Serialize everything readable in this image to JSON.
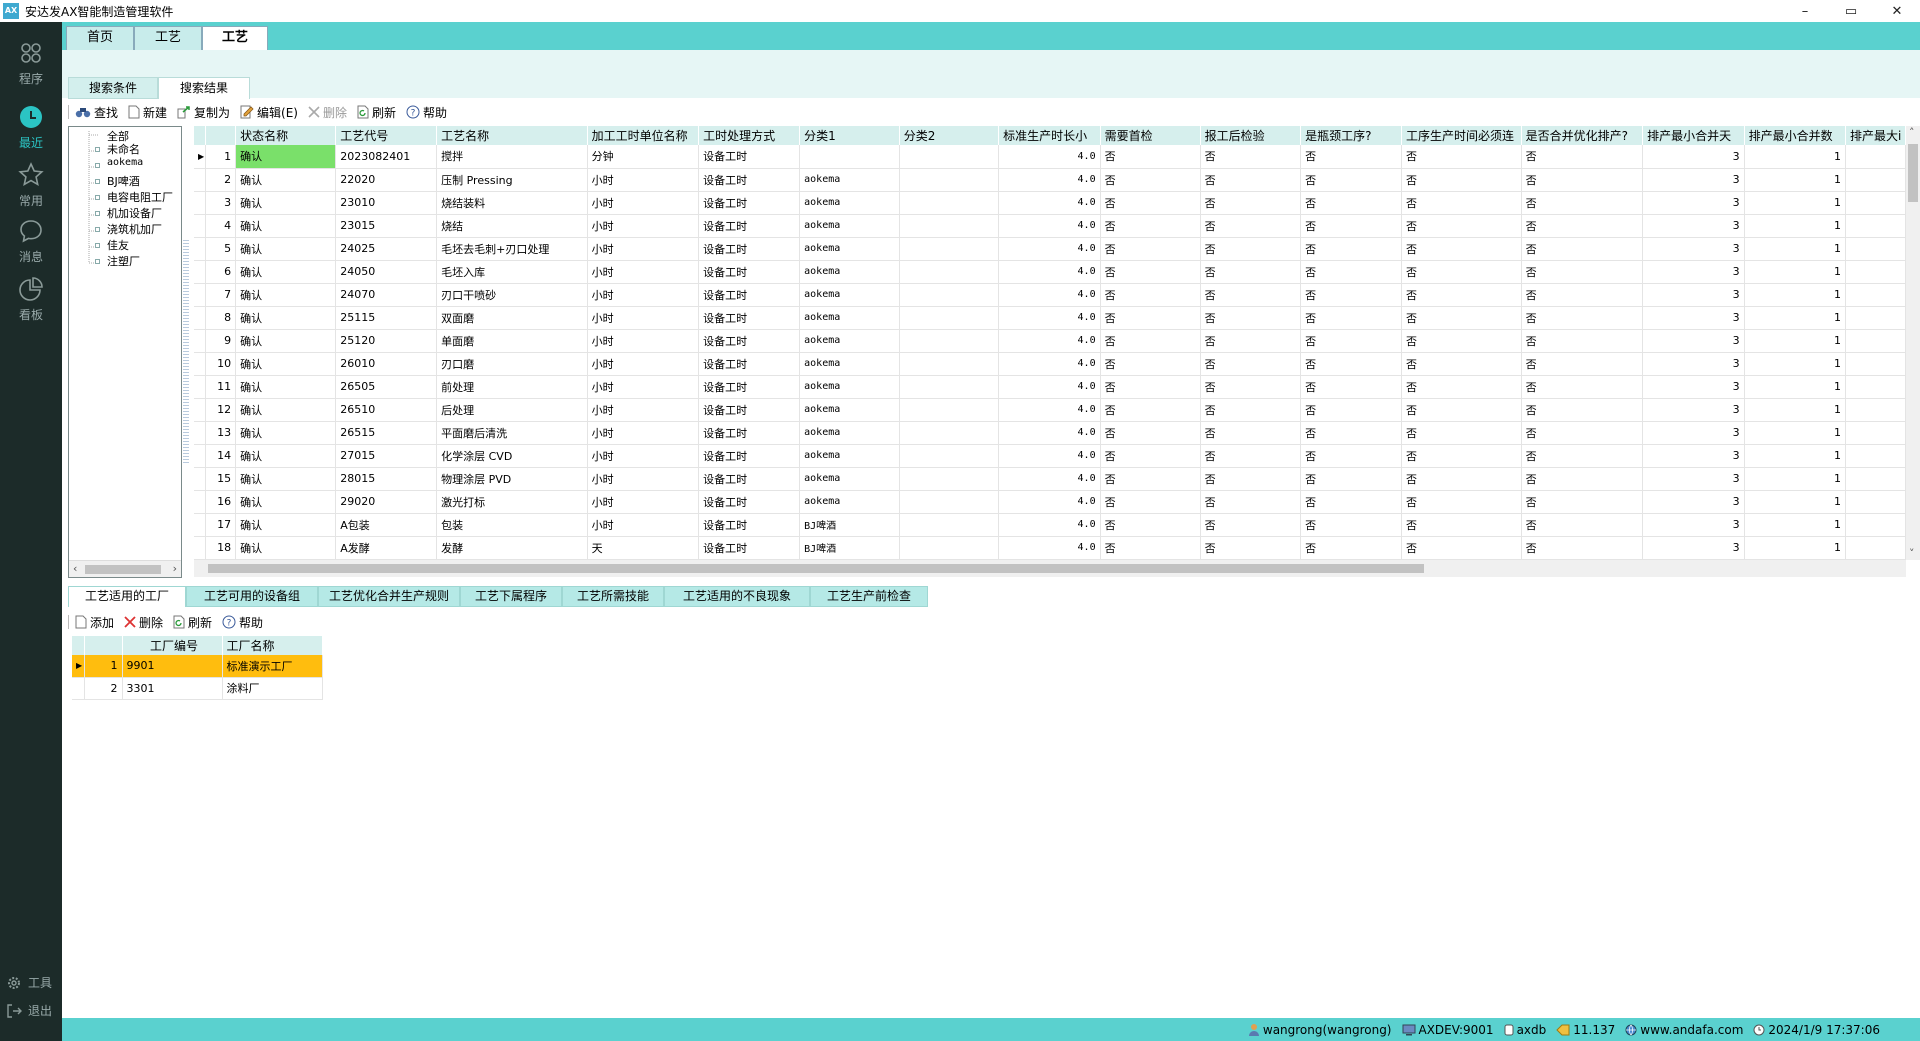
{
  "app": {
    "title": "安达发AX智能制造管理软件",
    "logo_text": "AX"
  },
  "window_buttons": {
    "minimize": "–",
    "maximize": "▭",
    "close": "✕"
  },
  "sidebar": {
    "items": [
      {
        "label": "程序",
        "icon": "grid-icon"
      },
      {
        "label": "最近",
        "icon": "clock-icon"
      },
      {
        "label": "常用",
        "icon": "star-icon"
      },
      {
        "label": "消息",
        "icon": "chat-icon"
      },
      {
        "label": "看板",
        "icon": "pie-chart-icon"
      }
    ],
    "active_index": 1,
    "tools_label": "工具",
    "logout_label": "退出"
  },
  "tabs": {
    "items": [
      "首页",
      "工艺",
      "工艺"
    ],
    "active_index": 2
  },
  "subtabs": {
    "items": [
      "搜索条件",
      "搜索结果"
    ],
    "active_index": 1
  },
  "toolbar": {
    "find": "查找",
    "new": "新建",
    "copy_as": "复制为",
    "edit": "编辑(E)",
    "delete": "删除",
    "refresh": "刷新",
    "help": "帮助"
  },
  "tree": {
    "items": [
      "全部",
      "未命名",
      "aokema",
      "BJ啤酒",
      "电容电阻工厂",
      "机加设备厂",
      "浇筑机加厂",
      "佳友",
      "注塑厂"
    ]
  },
  "grid": {
    "columns": [
      "状态名称",
      "工艺代号",
      "工艺名称",
      "加工工时单位名称",
      "工时处理方式",
      "分类1",
      "分类2",
      "标准生产时长小",
      "需要首检",
      "报工后检验",
      "是瓶颈工序?",
      "工序生产时间必须连",
      "是否合并优化排产?",
      "排产最小合并天",
      "排产最小合并数",
      "排产最大i"
    ],
    "rows": [
      {
        "n": "1",
        "status": "确认",
        "code": "2023082401",
        "name": "搅拌",
        "unit": "分钟",
        "method": "设备工时",
        "c1": "",
        "c2": "",
        "std": "4.0",
        "first": "否",
        "post": "否",
        "bottle": "否",
        "cont": "否",
        "merge": "否",
        "days": "3",
        "qty": "1"
      },
      {
        "n": "2",
        "status": "确认",
        "code": "22020",
        "name": "压制 Pressing",
        "unit": "小时",
        "method": "设备工时",
        "c1": "aokema",
        "c2": "",
        "std": "4.0",
        "first": "否",
        "post": "否",
        "bottle": "否",
        "cont": "否",
        "merge": "否",
        "days": "3",
        "qty": "1"
      },
      {
        "n": "3",
        "status": "确认",
        "code": "23010",
        "name": "烧结装料",
        "unit": "小时",
        "method": "设备工时",
        "c1": "aokema",
        "c2": "",
        "std": "4.0",
        "first": "否",
        "post": "否",
        "bottle": "否",
        "cont": "否",
        "merge": "否",
        "days": "3",
        "qty": "1"
      },
      {
        "n": "4",
        "status": "确认",
        "code": "23015",
        "name": "烧结",
        "unit": "小时",
        "method": "设备工时",
        "c1": "aokema",
        "c2": "",
        "std": "4.0",
        "first": "否",
        "post": "否",
        "bottle": "否",
        "cont": "否",
        "merge": "否",
        "days": "3",
        "qty": "1"
      },
      {
        "n": "5",
        "status": "确认",
        "code": "24025",
        "name": "毛坯去毛刺+刃口处理",
        "unit": "小时",
        "method": "设备工时",
        "c1": "aokema",
        "c2": "",
        "std": "4.0",
        "first": "否",
        "post": "否",
        "bottle": "否",
        "cont": "否",
        "merge": "否",
        "days": "3",
        "qty": "1"
      },
      {
        "n": "6",
        "status": "确认",
        "code": "24050",
        "name": "毛坯入库",
        "unit": "小时",
        "method": "设备工时",
        "c1": "aokema",
        "c2": "",
        "std": "4.0",
        "first": "否",
        "post": "否",
        "bottle": "否",
        "cont": "否",
        "merge": "否",
        "days": "3",
        "qty": "1"
      },
      {
        "n": "7",
        "status": "确认",
        "code": "24070",
        "name": "刃口干喷砂",
        "unit": "小时",
        "method": "设备工时",
        "c1": "aokema",
        "c2": "",
        "std": "4.0",
        "first": "否",
        "post": "否",
        "bottle": "否",
        "cont": "否",
        "merge": "否",
        "days": "3",
        "qty": "1"
      },
      {
        "n": "8",
        "status": "确认",
        "code": "25115",
        "name": "双面磨",
        "unit": "小时",
        "method": "设备工时",
        "c1": "aokema",
        "c2": "",
        "std": "4.0",
        "first": "否",
        "post": "否",
        "bottle": "否",
        "cont": "否",
        "merge": "否",
        "days": "3",
        "qty": "1"
      },
      {
        "n": "9",
        "status": "确认",
        "code": "25120",
        "name": "单面磨",
        "unit": "小时",
        "method": "设备工时",
        "c1": "aokema",
        "c2": "",
        "std": "4.0",
        "first": "否",
        "post": "否",
        "bottle": "否",
        "cont": "否",
        "merge": "否",
        "days": "3",
        "qty": "1"
      },
      {
        "n": "10",
        "status": "确认",
        "code": "26010",
        "name": "刃口磨",
        "unit": "小时",
        "method": "设备工时",
        "c1": "aokema",
        "c2": "",
        "std": "4.0",
        "first": "否",
        "post": "否",
        "bottle": "否",
        "cont": "否",
        "merge": "否",
        "days": "3",
        "qty": "1"
      },
      {
        "n": "11",
        "status": "确认",
        "code": "26505",
        "name": "前处理",
        "unit": "小时",
        "method": "设备工时",
        "c1": "aokema",
        "c2": "",
        "std": "4.0",
        "first": "否",
        "post": "否",
        "bottle": "否",
        "cont": "否",
        "merge": "否",
        "days": "3",
        "qty": "1"
      },
      {
        "n": "12",
        "status": "确认",
        "code": "26510",
        "name": "后处理",
        "unit": "小时",
        "method": "设备工时",
        "c1": "aokema",
        "c2": "",
        "std": "4.0",
        "first": "否",
        "post": "否",
        "bottle": "否",
        "cont": "否",
        "merge": "否",
        "days": "3",
        "qty": "1"
      },
      {
        "n": "13",
        "status": "确认",
        "code": "26515",
        "name": "平面磨后清洗",
        "unit": "小时",
        "method": "设备工时",
        "c1": "aokema",
        "c2": "",
        "std": "4.0",
        "first": "否",
        "post": "否",
        "bottle": "否",
        "cont": "否",
        "merge": "否",
        "days": "3",
        "qty": "1"
      },
      {
        "n": "14",
        "status": "确认",
        "code": "27015",
        "name": "化学涂层 CVD",
        "unit": "小时",
        "method": "设备工时",
        "c1": "aokema",
        "c2": "",
        "std": "4.0",
        "first": "否",
        "post": "否",
        "bottle": "否",
        "cont": "否",
        "merge": "否",
        "days": "3",
        "qty": "1"
      },
      {
        "n": "15",
        "status": "确认",
        "code": "28015",
        "name": "物理涂层 PVD",
        "unit": "小时",
        "method": "设备工时",
        "c1": "aokema",
        "c2": "",
        "std": "4.0",
        "first": "否",
        "post": "否",
        "bottle": "否",
        "cont": "否",
        "merge": "否",
        "days": "3",
        "qty": "1"
      },
      {
        "n": "16",
        "status": "确认",
        "code": "29020",
        "name": "激光打标",
        "unit": "小时",
        "method": "设备工时",
        "c1": "aokema",
        "c2": "",
        "std": "4.0",
        "first": "否",
        "post": "否",
        "bottle": "否",
        "cont": "否",
        "merge": "否",
        "days": "3",
        "qty": "1"
      },
      {
        "n": "17",
        "status": "确认",
        "code": "A包装",
        "name": "包装",
        "unit": "小时",
        "method": "设备工时",
        "c1": "BJ啤酒",
        "c2": "",
        "std": "4.0",
        "first": "否",
        "post": "否",
        "bottle": "否",
        "cont": "否",
        "merge": "否",
        "days": "3",
        "qty": "1"
      },
      {
        "n": "18",
        "status": "确认",
        "code": "A发酵",
        "name": "发酵",
        "unit": "天",
        "method": "设备工时",
        "c1": "BJ啤酒",
        "c2": "",
        "std": "4.0",
        "first": "否",
        "post": "否",
        "bottle": "否",
        "cont": "否",
        "merge": "否",
        "days": "3",
        "qty": "1"
      }
    ]
  },
  "bottom_tabs": {
    "items": [
      "工艺适用的工厂",
      "工艺可用的设备组",
      "工艺优化合并生产规则",
      "工艺下属程序",
      "工艺所需技能",
      "工艺适用的不良现象",
      "工艺生产前检查"
    ],
    "active_index": 0
  },
  "bottom_toolbar": {
    "add": "添加",
    "delete": "删除",
    "refresh": "刷新",
    "help": "帮助"
  },
  "subgrid": {
    "columns": [
      "工厂编号",
      "工厂名称"
    ],
    "rows": [
      {
        "n": "1",
        "code": "9901",
        "name": "标准演示工厂"
      },
      {
        "n": "2",
        "code": "3301",
        "name": "涂料厂"
      }
    ]
  },
  "status": {
    "user": "wangrong(wangrong)",
    "server": "AXDEV:9001",
    "db": "axdb",
    "version": "11.137",
    "website": "www.andafa.com",
    "datetime": "2024/1/9 17:37:06"
  },
  "colors": {
    "accent": "#5ad1cf",
    "sidebar_bg": "#1c2b29",
    "selected_cell": "#7ae06a",
    "highlight_row": "#ffbd0e"
  }
}
